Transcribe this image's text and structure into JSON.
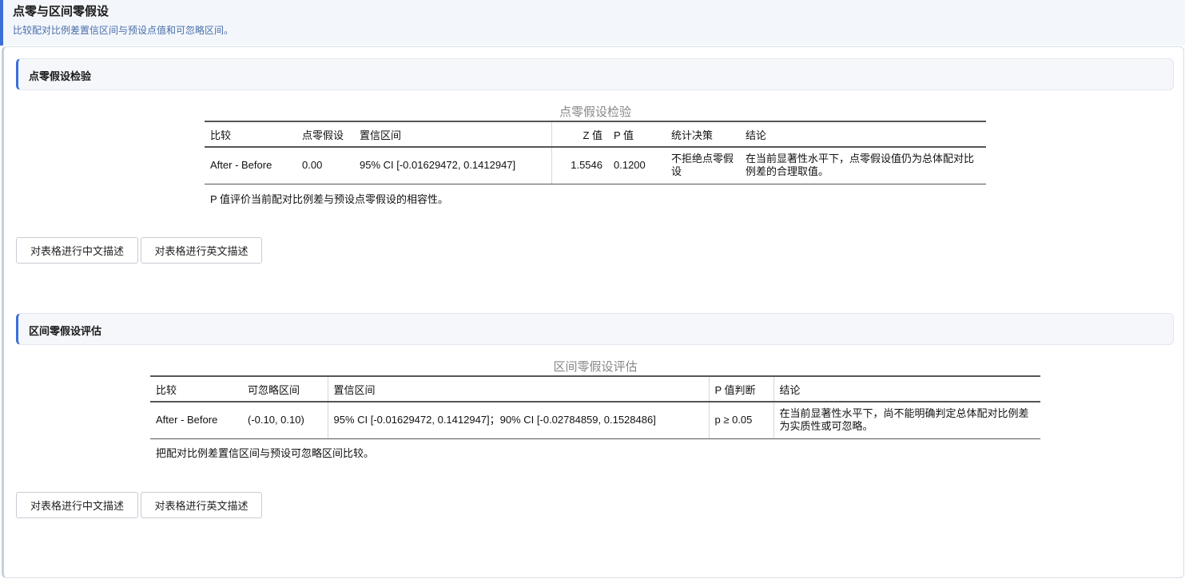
{
  "header": {
    "title": "点零与区间零假设",
    "subtitle": "比较配对比例差置信区间与预设点值和可忽略区间。"
  },
  "point_section": {
    "heading": "点零假设检验",
    "caption": "点零假设检验",
    "columns": [
      "比较",
      "点零假设",
      "置信区间",
      "Z 值",
      "P 值",
      "统计决策",
      "结论"
    ],
    "row": {
      "comparison": "After - Before",
      "null_value": "0.00",
      "ci": "95% CI [-0.01629472, 0.1412947]",
      "z": "1.5546",
      "p": "0.1200",
      "decision": "不拒绝点零假设",
      "conclusion": "在当前显著性水平下，点零假设值仍为总体配对比例差的合理取值。"
    },
    "note": "P 值评价当前配对比例差与预设点零假设的相容性。",
    "btn_cn": "对表格进行中文描述",
    "btn_en": "对表格进行英文描述"
  },
  "interval_section": {
    "heading": "区间零假设评估",
    "caption": "区间零假设评估",
    "columns": [
      "比较",
      "可忽略区间",
      "置信区间",
      "P 值判断",
      "结论"
    ],
    "row": {
      "comparison": "After - Before",
      "region": "(-0.10, 0.10)",
      "ci": "95% CI [-0.01629472, 0.1412947]；90% CI [-0.02784859, 0.1528486]",
      "p_judgment": "p ≥ 0.05",
      "conclusion": "在当前显著性水平下，尚不能明确判定总体配对比例差为实质性或可忽略。"
    },
    "note": "把配对比例差置信区间与预设可忽略区间比较。",
    "btn_cn": "对表格进行中文描述",
    "btn_en": "对表格进行英文描述"
  }
}
